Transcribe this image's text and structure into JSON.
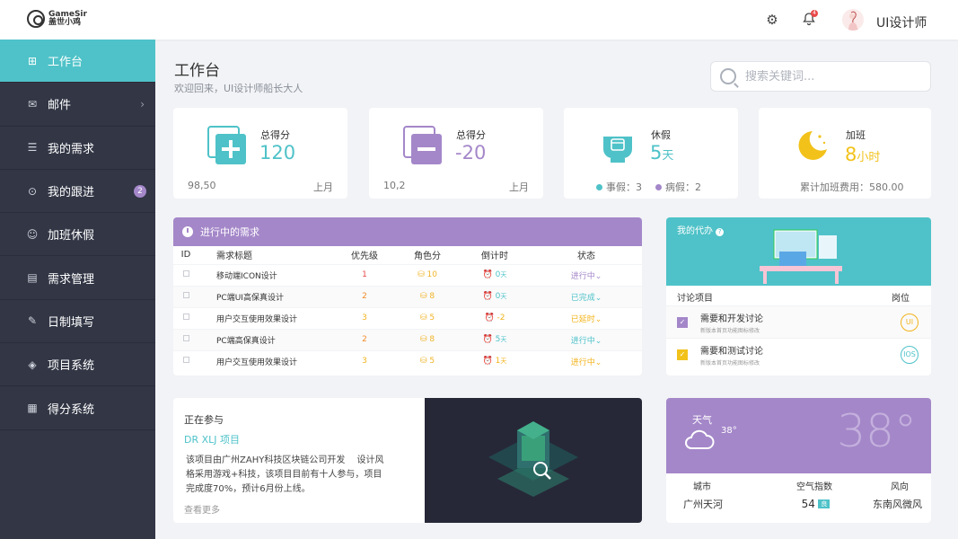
{
  "app": {
    "logo_line1": "GameSir",
    "logo_line2": "盖世小鸡",
    "notification_count": "4",
    "username": "UI设计师"
  },
  "sidebar": {
    "items": [
      {
        "label": "工作台",
        "icon": "grid-icon",
        "active": true
      },
      {
        "label": "邮件",
        "icon": "mail-icon",
        "arrow": true
      },
      {
        "label": "我的需求",
        "icon": "list-icon"
      },
      {
        "label": "我的跟进",
        "icon": "target-icon",
        "badge": "2"
      },
      {
        "label": "加班休假",
        "icon": "user-search-icon"
      },
      {
        "label": "需求管理",
        "icon": "folder-icon"
      },
      {
        "label": "日制填写",
        "icon": "edit-icon"
      },
      {
        "label": "项目系统",
        "icon": "layers-icon"
      },
      {
        "label": "得分系统",
        "icon": "score-icon"
      }
    ]
  },
  "header": {
    "title": "工作台",
    "subtitle": "欢迎回来，UI设计师船长大人"
  },
  "search": {
    "placeholder": "搜索关键词..."
  },
  "stats": [
    {
      "label": "总得分",
      "value": "120",
      "foot_left": "98,50",
      "foot_right": "上月",
      "color": "#4ec2c8"
    },
    {
      "label": "总得分",
      "value": "-20",
      "foot_left": "10,2",
      "foot_right": "上月",
      "color": "#a487c9"
    },
    {
      "label": "休假",
      "value": "5",
      "unit": "天",
      "leave1": "事假：3",
      "leave2": "病假：2",
      "color": "#4ec2c8"
    },
    {
      "label": "加班",
      "value": "8",
      "unit": "小时",
      "foot_left": "累计加班费用：580.00",
      "color": "#f2c21b"
    }
  ],
  "demands": {
    "title": "进行中的需求",
    "headers": [
      "ID",
      "需求标题",
      "优先级",
      "角色分",
      "倒计时",
      "状态"
    ],
    "rows": [
      {
        "title": "移动端ICON设计",
        "priority": "1",
        "pcolor": "#e84a4a",
        "score": "10",
        "countdown": "0",
        "cunit": "天",
        "ccolor": "#4ec2c8",
        "status": "进行中",
        "scolor": "#a487c9"
      },
      {
        "title": "PC端UI高保真设计",
        "priority": "2",
        "pcolor": "#f28c28",
        "score": "8",
        "countdown": "0",
        "cunit": "天",
        "ccolor": "#4ec2c8",
        "status": "已完成",
        "scolor": "#4ec2c8"
      },
      {
        "title": "用户交互使用效果设计",
        "priority": "3",
        "pcolor": "#f2b31b",
        "score": "5",
        "countdown": "-2",
        "cunit": "",
        "ccolor": "#f2b31b",
        "status": "已延时",
        "scolor": "#f2b31b"
      },
      {
        "title": "PC端高保真设计",
        "priority": "2",
        "pcolor": "#f28c28",
        "score": "8",
        "countdown": "5",
        "cunit": "天",
        "ccolor": "#4ec2c8",
        "status": "进行中",
        "scolor": "#4ec2c8"
      },
      {
        "title": "用户交互使用效果设计",
        "priority": "3",
        "pcolor": "#f2b31b",
        "score": "5",
        "countdown": "1",
        "cunit": "天",
        "ccolor": "#f2b31b",
        "status": "进行中",
        "scolor": "#f2b31b"
      }
    ]
  },
  "delegate": {
    "title": "我的代办",
    "col1": "讨论项目",
    "col2": "岗位",
    "items": [
      {
        "title": "需要和开发讨论",
        "desc": "新版本首页功能图标修改",
        "role": "UI",
        "color": "#a487c9",
        "rcolor": "#f2b31b"
      },
      {
        "title": "需要和测试讨论",
        "desc": "新版本首页功能图标修改",
        "role": "IOS",
        "color": "#f2c21b",
        "rcolor": "#4ec2c8"
      }
    ]
  },
  "project": {
    "title": "正在参与",
    "name": "DR XLJ 项目",
    "desc": "该项目由广州ZAHY科技区块链公司开发　 设计风格采用游戏+科技，该项目目前有十人参与，项目完成度70%，预计6月份上线。",
    "more": "查看更多"
  },
  "weather": {
    "label": "天气",
    "temp_small": "38°",
    "temp_big": "38°",
    "cols": [
      "城市",
      "空气指数",
      "风向"
    ],
    "city": "广州天河",
    "aqi": "54",
    "aqi_tag": "良",
    "wind": "东南风微风"
  },
  "colors": {
    "teal": "#4ec2c8",
    "purple": "#a487c9",
    "sidebar": "#323645"
  }
}
